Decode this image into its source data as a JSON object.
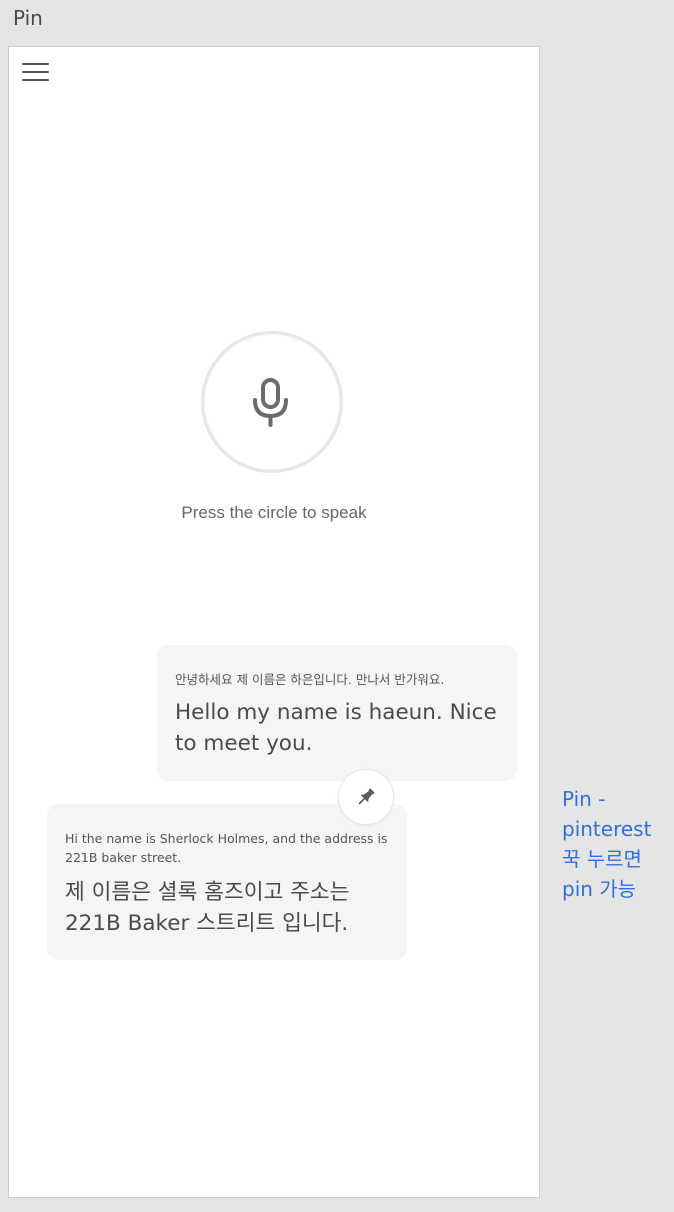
{
  "page_label": "Pin",
  "menu": {
    "icon": "hamburger-menu-icon"
  },
  "mic": {
    "icon": "microphone-icon",
    "hint": "Press the circle to speak"
  },
  "messages": [
    {
      "source_text": "안녕하세요 제 이름은 하은입니다. 만나서 반가워요.",
      "translated_text": "Hello my name is haeun. Nice to meet you."
    },
    {
      "source_text": "Hi the name is Sherlock Holmes, and the address is 221B baker street.",
      "translated_text": "제 이름은 셜록 홈즈이고 주소는 221B Baker 스트리트 입니다."
    }
  ],
  "pin": {
    "icon": "pin-icon"
  },
  "annotation": {
    "lines": [
      "Pin -",
      "pinterest",
      "꾹 누르면",
      "pin 가능"
    ],
    "color": "#2f6fe0"
  }
}
